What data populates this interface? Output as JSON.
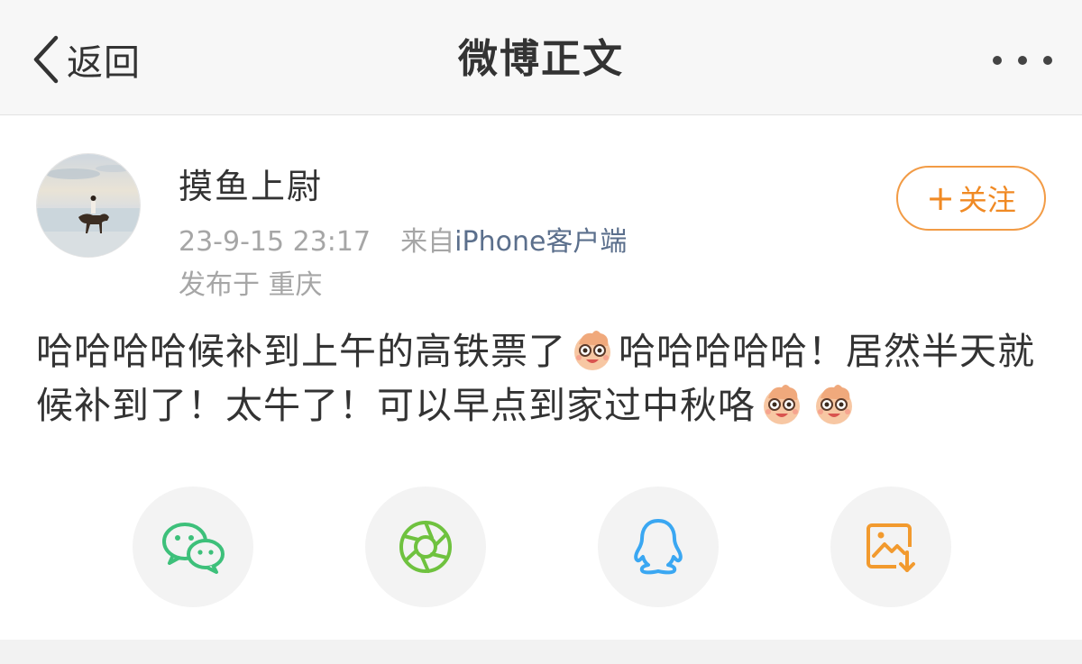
{
  "nav": {
    "back_label": "返回",
    "title": "微博正文"
  },
  "author": {
    "name": "摸鱼上尉",
    "datetime": "23-9-15 23:17",
    "from_prefix": "来自",
    "source": "iPhone客户端",
    "location_prefix": "发布于",
    "location": "重庆",
    "follow_label": "关注"
  },
  "post": {
    "segment_1": "哈哈哈哈候补到上午的高铁票了",
    "segment_2": "哈哈哈哈哈！居然半天就候补到了！太牛了！可以早点到家过中秋咯",
    "emoji_count": 3
  },
  "share": {
    "items": [
      "wechat-icon",
      "moments-icon",
      "qq-icon",
      "save-image-icon"
    ]
  },
  "colors": {
    "accent": "#f08a24",
    "wechat": "#3dc07a",
    "qq": "#3aa7f2",
    "save": "#f29a2e",
    "source_link": "#5b6f8c"
  }
}
